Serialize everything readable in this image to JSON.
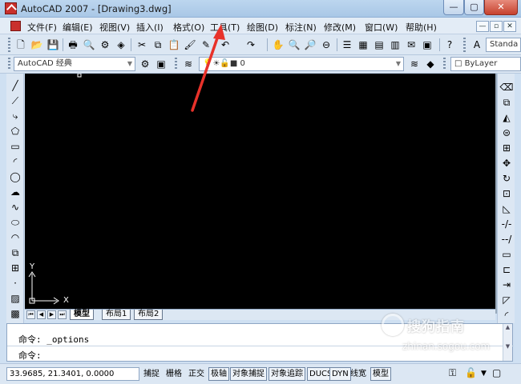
{
  "window": {
    "title": "AutoCAD 2007 - [Drawing3.dwg]",
    "controls": {
      "minimize": "—",
      "maximize": "▢",
      "close": "✕"
    }
  },
  "menu": {
    "items": [
      {
        "label": "文件(F)"
      },
      {
        "label": "编辑(E)"
      },
      {
        "label": "视图(V)"
      },
      {
        "label": "插入(I)"
      },
      {
        "label": "格式(O)"
      },
      {
        "label": "工具(T)"
      },
      {
        "label": "绘图(D)"
      },
      {
        "label": "标注(N)"
      },
      {
        "label": "修改(M)"
      },
      {
        "label": "窗口(W)"
      },
      {
        "label": "帮助(H)"
      }
    ],
    "mdi_controls": [
      "—",
      "▫",
      "✕"
    ]
  },
  "toolbar": {
    "text_style": "Standa"
  },
  "toolbar2": {
    "workspace": "AutoCAD 经典",
    "layer": "0",
    "linetype_combo": "ByLayer"
  },
  "canvas": {
    "background": "#000000",
    "ucs_y": "Y",
    "ucs_x": "X"
  },
  "tabs": {
    "nav": [
      "⏮",
      "◀",
      "▶",
      "⏭"
    ],
    "items": [
      {
        "label": "模型",
        "active": true
      },
      {
        "label": "布局1",
        "active": false
      },
      {
        "label": "布局2",
        "active": false
      }
    ]
  },
  "command": {
    "history": "命令: _options",
    "prompt": "命令:"
  },
  "status": {
    "coords": "33.9685, 21.3401, 0.0000",
    "buttons": [
      {
        "label": "捕捉",
        "pressed": false
      },
      {
        "label": "栅格",
        "pressed": false
      },
      {
        "label": "正交",
        "pressed": false
      },
      {
        "label": "极轴",
        "pressed": true
      },
      {
        "label": "对象捕捉",
        "pressed": true
      },
      {
        "label": "对象追踪",
        "pressed": true
      },
      {
        "label": "DUCS",
        "pressed": true
      },
      {
        "label": "DYN",
        "pressed": true
      },
      {
        "label": "线宽",
        "pressed": false
      },
      {
        "label": "模型",
        "pressed": true
      }
    ]
  },
  "watermark": {
    "brand": "搜狗指南",
    "url": "zhinan.sogou.com"
  },
  "colors": {
    "annotation_arrow": "#e8322a",
    "title_bar": "#b5d0ec",
    "close_button": "#c6412d"
  }
}
